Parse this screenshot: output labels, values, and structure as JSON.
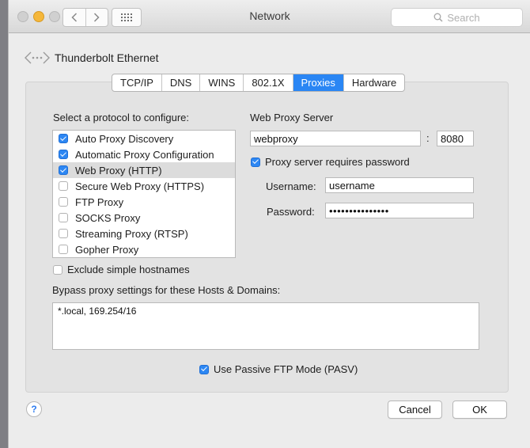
{
  "window": {
    "title": "Network"
  },
  "toolbar": {
    "search_placeholder": "Search"
  },
  "service": {
    "name": "Thunderbolt Ethernet"
  },
  "tabs": [
    {
      "label": "TCP/IP",
      "active": false
    },
    {
      "label": "DNS",
      "active": false
    },
    {
      "label": "WINS",
      "active": false
    },
    {
      "label": "802.1X",
      "active": false
    },
    {
      "label": "Proxies",
      "active": true
    },
    {
      "label": "Hardware",
      "active": false
    }
  ],
  "protocols": {
    "heading": "Select a protocol to configure:",
    "items": [
      {
        "label": "Auto Proxy Discovery",
        "checked": true,
        "selected": false
      },
      {
        "label": "Automatic Proxy Configuration",
        "checked": true,
        "selected": false
      },
      {
        "label": "Web Proxy (HTTP)",
        "checked": true,
        "selected": true
      },
      {
        "label": "Secure Web Proxy (HTTPS)",
        "checked": false,
        "selected": false
      },
      {
        "label": "FTP Proxy",
        "checked": false,
        "selected": false
      },
      {
        "label": "SOCKS Proxy",
        "checked": false,
        "selected": false
      },
      {
        "label": "Streaming Proxy (RTSP)",
        "checked": false,
        "selected": false
      },
      {
        "label": "Gopher Proxy",
        "checked": false,
        "selected": false
      }
    ]
  },
  "server": {
    "heading": "Web Proxy Server",
    "host": "webproxy",
    "separator": ":",
    "port": "8080",
    "requires_password_label": "Proxy server requires password",
    "requires_password": true,
    "username_label": "Username:",
    "username": "username",
    "password_label": "Password:",
    "password": "•••••••••••••••"
  },
  "exclude": {
    "label": "Exclude simple hostnames",
    "checked": false
  },
  "bypass": {
    "label": "Bypass proxy settings for these Hosts & Domains:",
    "value": "*.local, 169.254/16"
  },
  "pasv": {
    "label": "Use Passive FTP Mode (PASV)",
    "checked": true
  },
  "buttons": {
    "help": "?",
    "cancel": "Cancel",
    "ok": "OK"
  },
  "colors": {
    "accent": "#2a86f4",
    "minimize": "#f5b73a"
  }
}
